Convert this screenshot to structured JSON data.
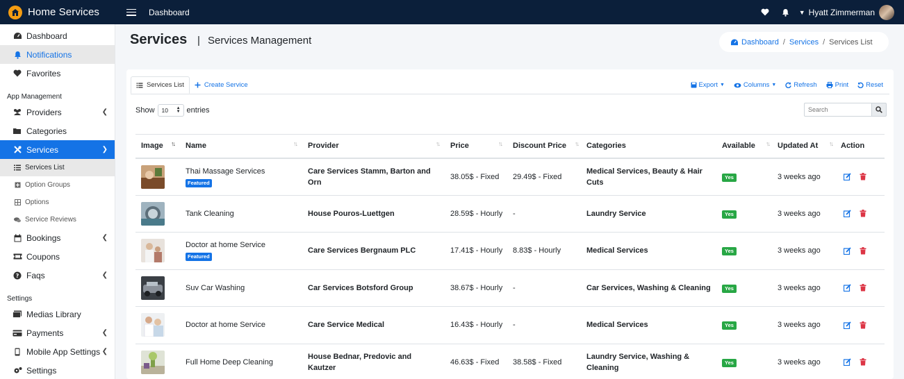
{
  "app": {
    "brand": "Home Services",
    "nav_link": "Dashboard",
    "user_name": "Hyatt Zimmerman"
  },
  "sidebar": {
    "top_items": [
      {
        "label": "Dashboard",
        "icon": "dashboard-icon"
      },
      {
        "label": "Notifications",
        "icon": "bell-icon"
      },
      {
        "label": "Favorites",
        "icon": "heart-icon"
      }
    ],
    "app_management_header": "App Management",
    "app_items": [
      {
        "label": "Providers",
        "icon": "users-icon"
      },
      {
        "label": "Categories",
        "icon": "folder-icon"
      },
      {
        "label": "Services",
        "icon": "tools-icon"
      }
    ],
    "service_subitems": [
      {
        "label": "Services List",
        "icon": "list-icon"
      },
      {
        "label": "Option Groups",
        "icon": "plus-square-icon"
      },
      {
        "label": "Options",
        "icon": "grid-icon"
      },
      {
        "label": "Service Reviews",
        "icon": "comments-icon"
      }
    ],
    "app_items_2": [
      {
        "label": "Bookings",
        "icon": "calendar-icon"
      },
      {
        "label": "Coupons",
        "icon": "ticket-icon"
      },
      {
        "label": "Faqs",
        "icon": "question-icon"
      }
    ],
    "settings_header": "Settings",
    "settings_items": [
      {
        "label": "Medias Library",
        "icon": "images-icon"
      },
      {
        "label": "Payments",
        "icon": "credit-card-icon"
      },
      {
        "label": "Mobile App Settings",
        "icon": "mobile-icon"
      },
      {
        "label": "Settings",
        "icon": "cogs-icon"
      }
    ]
  },
  "page": {
    "title": "Services",
    "separator": "|",
    "subtitle": "Services Management",
    "breadcrumb": {
      "home": "Dashboard",
      "section": "Services",
      "current": "Services List",
      "sep": "/"
    }
  },
  "card": {
    "tab_list": "Services List",
    "tab_create": "Create Service",
    "tools": {
      "export": "Export",
      "columns": "Columns",
      "refresh": "Refresh",
      "print": "Print",
      "reset": "Reset"
    },
    "show": "Show",
    "entries_value": "10",
    "entries": "entries",
    "search_placeholder": "Search"
  },
  "table": {
    "headers": {
      "image": "Image",
      "name": "Name",
      "provider": "Provider",
      "price": "Price",
      "discount": "Discount Price",
      "categories": "Categories",
      "available": "Available",
      "updated": "Updated At",
      "action": "Action"
    },
    "featured_label": "Featured",
    "rows": [
      {
        "name": "Thai Massage Services",
        "featured": true,
        "provider": "Care Services Stamm, Barton and Orn",
        "price": "38.05$ - Fixed",
        "discount": "29.49$ - Fixed",
        "categories": "Medical Services, Beauty & Hair Cuts",
        "available": "Yes",
        "updated": "3 weeks ago"
      },
      {
        "name": "Tank Cleaning",
        "featured": false,
        "provider": "House Pouros-Luettgen",
        "price": "28.59$ - Hourly",
        "discount": "-",
        "categories": "Laundry Service",
        "available": "Yes",
        "updated": "3 weeks ago"
      },
      {
        "name": "Doctor at home Service",
        "featured": true,
        "provider": "Care Services Bergnaum PLC",
        "price": "17.41$ - Hourly",
        "discount": "8.83$ - Hourly",
        "categories": "Medical Services",
        "available": "Yes",
        "updated": "3 weeks ago"
      },
      {
        "name": "Suv Car Washing",
        "featured": false,
        "provider": "Car Services Botsford Group",
        "price": "38.67$ - Hourly",
        "discount": "-",
        "categories": "Car Services, Washing & Cleaning",
        "available": "Yes",
        "updated": "3 weeks ago"
      },
      {
        "name": "Doctor at home Service",
        "featured": false,
        "provider": "Care Service Medical",
        "price": "16.43$ - Hourly",
        "discount": "-",
        "categories": "Medical Services",
        "available": "Yes",
        "updated": "3 weeks ago"
      },
      {
        "name": "Full Home Deep Cleaning",
        "featured": false,
        "provider": "House Bednar, Predovic and Kautzer",
        "price": "46.63$ - Fixed",
        "discount": "38.58$ - Fixed",
        "categories": "Laundry Service, Washing & Cleaning",
        "available": "Yes",
        "updated": "3 weeks ago"
      }
    ]
  },
  "colors": {
    "navbar": "#0b1f3a",
    "accent": "#1473e6",
    "success": "#28a745",
    "danger": "#dc3545",
    "logo": "#f39c12"
  }
}
